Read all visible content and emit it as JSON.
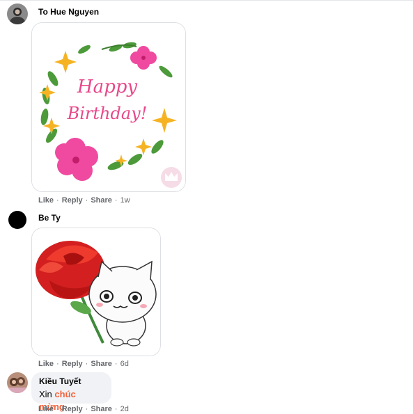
{
  "comments": [
    {
      "author": "To Hue Nguyen",
      "sticker": "happy-birthday-card",
      "sticker_text_1": "Happy",
      "sticker_text_2": "Birthday!",
      "actions": {
        "like": "Like",
        "reply": "Reply",
        "share": "Share",
        "time": "1w"
      }
    },
    {
      "author": "Be Ty",
      "sticker": "cat-holding-rose",
      "actions": {
        "like": "Like",
        "reply": "Reply",
        "share": "Share",
        "time": "6d"
      }
    },
    {
      "author": "Kiều Tuyết",
      "text_prefix": "Xin ",
      "text_link": "chúc mừng",
      "actions": {
        "like": "Like",
        "reply": "Reply",
        "share": "Share",
        "time": "2d"
      }
    }
  ],
  "separator": "·",
  "colors": {
    "action_text": "#65676b",
    "link": "#f2623d",
    "bubble_bg": "#f0f2f5"
  }
}
